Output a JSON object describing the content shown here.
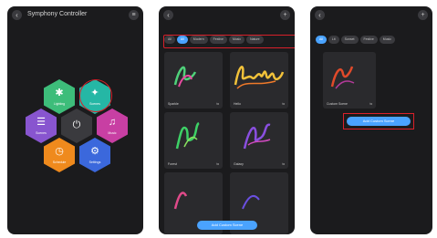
{
  "panel1": {
    "title": "Symphony Controller",
    "hexes": [
      {
        "label": "Lighting",
        "icon": "✱",
        "color": "#3dbd7a"
      },
      {
        "label": "Scenes",
        "icon": "✦",
        "color": "#25b7a5"
      },
      {
        "label": "Scenes",
        "icon": "☰",
        "color": "#8855cf"
      },
      {
        "label": "",
        "icon": "⏻",
        "color": "#3a3a3e"
      },
      {
        "label": "Music",
        "icon": "♫",
        "color": "#c83fa3"
      },
      {
        "label": "Schedule",
        "icon": "◷",
        "color": "#ef8a1d"
      },
      {
        "label": "Settings",
        "icon": "⚙",
        "color": "#3b68dc"
      }
    ]
  },
  "panel2": {
    "tabs": [
      "All",
      "All",
      "Modern",
      "Festive",
      "Music",
      "Nature"
    ],
    "cards": [
      {
        "name": "Sparkle",
        "badge": "⇆"
      },
      {
        "name": "Hello",
        "badge": "⇆"
      },
      {
        "name": "Forest",
        "badge": "⇆"
      },
      {
        "name": "Galaxy",
        "badge": "⇆"
      },
      {
        "name": "",
        "badge": ""
      },
      {
        "name": "",
        "badge": ""
      }
    ],
    "button": "Add Custom Scene"
  },
  "panel3": {
    "tabs": [
      "All",
      "Lit",
      "Sunset",
      "Festive",
      "Music"
    ],
    "card": {
      "name": "Custom Scene",
      "badge": "⇆"
    },
    "button": "Add Custom Scene"
  },
  "colors": {
    "accent": "#4aa3ff",
    "highlight": "#d8202a"
  }
}
